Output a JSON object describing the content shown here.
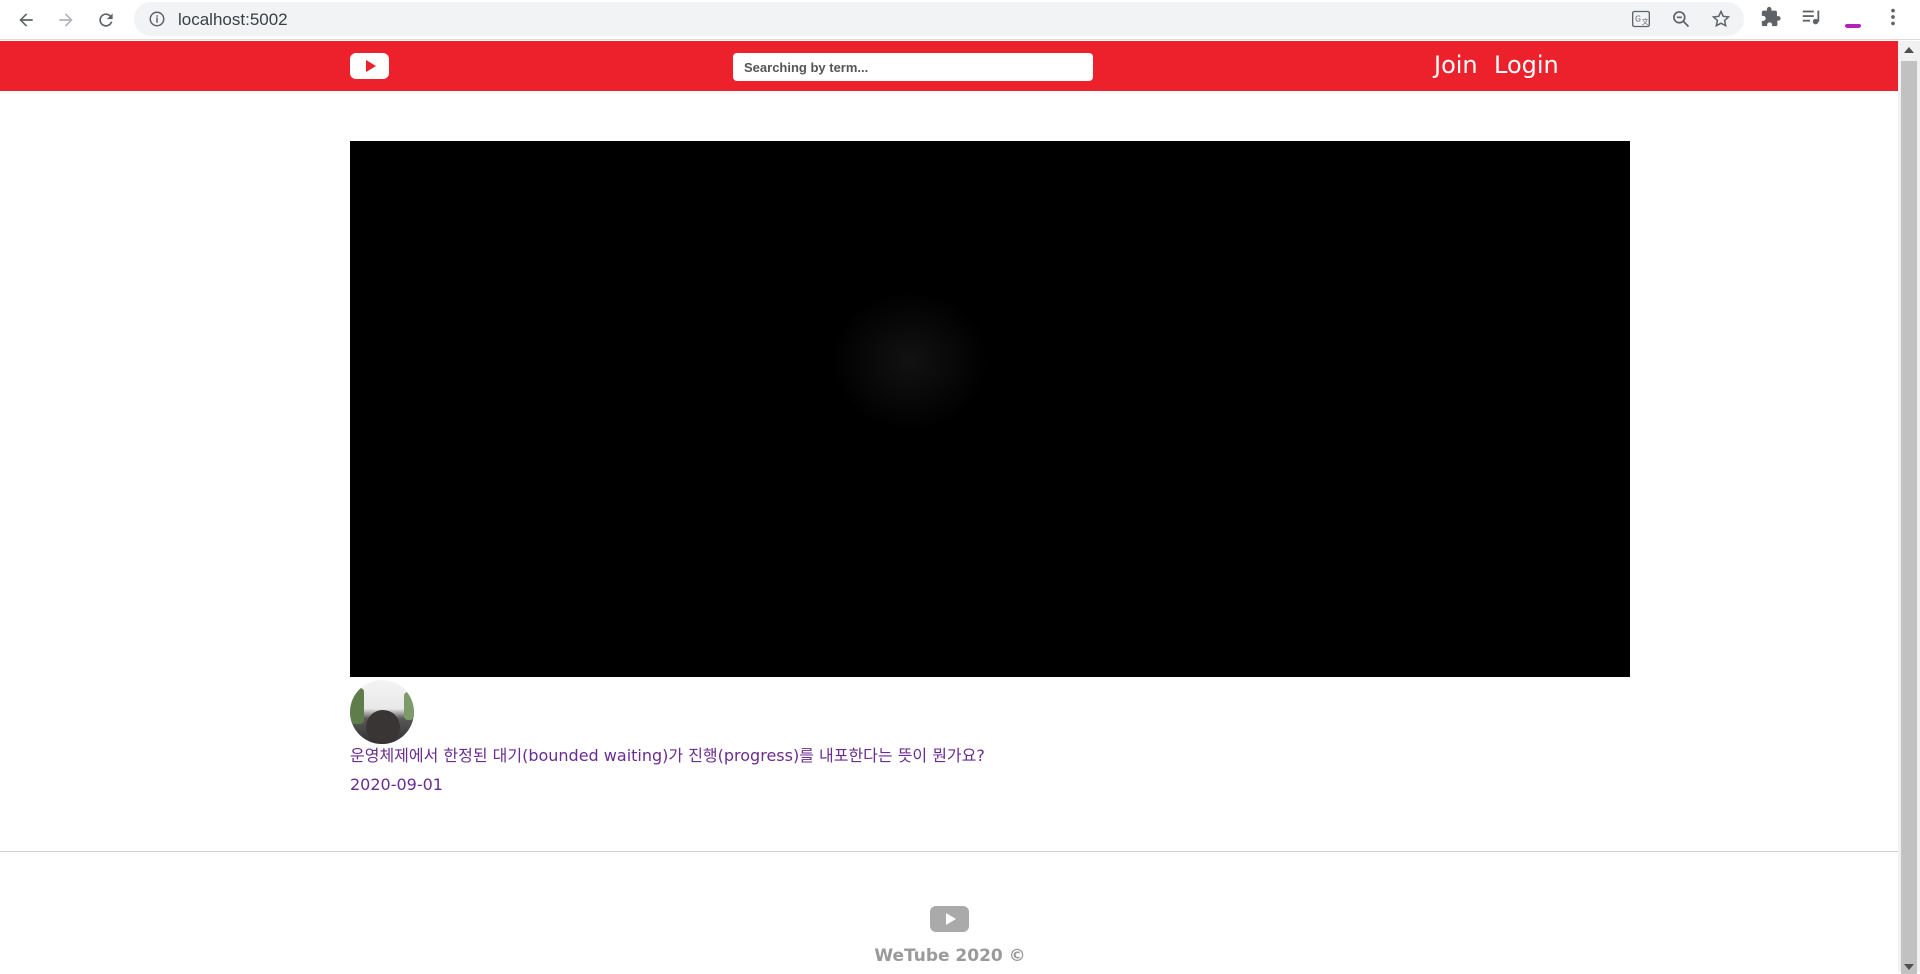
{
  "browser": {
    "url": "localhost:5002",
    "icons": [
      "back-icon",
      "forward-icon",
      "reload-icon",
      "info-icon",
      "translate-icon",
      "zoom-out-icon",
      "bookmark-star-icon",
      "extensions-icon",
      "media-playlist-icon",
      "profile-avatar",
      "menu-kebab-icon"
    ]
  },
  "header": {
    "search_placeholder": "Searching by term...",
    "join_label": "Join",
    "login_label": "Login",
    "accent_color": "#ed212c"
  },
  "video": {
    "title": "운영체제에서 한정된 대기(bounded waiting)가 진행(progress)를 내포한다는 뜻이 뭔가요?",
    "date": "2020-09-01",
    "link_color": "#6a2c91"
  },
  "footer": {
    "text": "WeTube 2020 ©"
  }
}
